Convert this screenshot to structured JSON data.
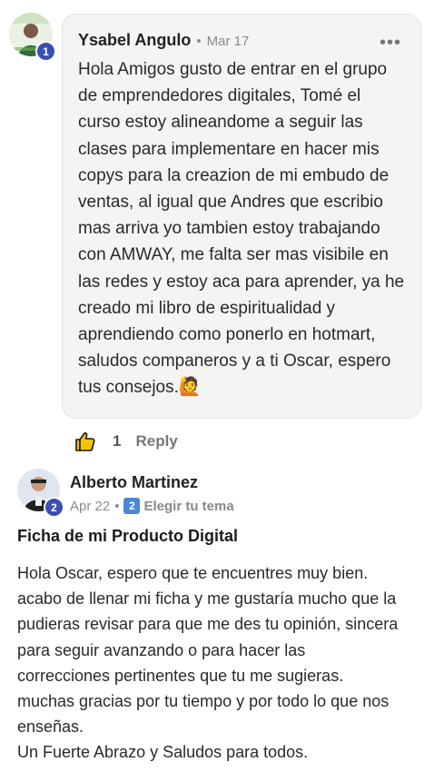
{
  "comment": {
    "author": "Ysabel Angulo",
    "separator": "•",
    "date": "Mar 17",
    "level": "1",
    "more_icon": "more-horizontal-icon",
    "more_label": "•••",
    "body": "Hola Amigos gusto de entrar en el grupo\nde emprendedores digitales, Tomé el\ncurso estoy alineandome a seguir las\nclases para implementare en hacer mis\ncopys para la creazion de mi embudo de\nventas, al igual que Andres que escribio\nmas arriva yo tambien estoy trabajando\ncon AMWAY, me falta ser mas visibile en\nlas redes y estoy aca para aprender, ya he\ncreado mi libro de espiritualidad y\naprendiendo como ponerlo en hotmart,\nsaludos companeros y a ti Oscar, espero\ntus consejos.",
    "emoji": "🙋",
    "like_count": "1",
    "reply_label": "Reply",
    "like_icon": "thumbs-up-icon"
  },
  "post": {
    "author": "Alberto Martinez",
    "level": "2",
    "date": "Apr 22",
    "separator": "•",
    "category_badge": "2",
    "category": "Elegir tu tema",
    "title": "Ficha de mi Producto Digital",
    "body": "Hola Oscar, espero que te encuentres muy bien.\nacabo de llenar mi ficha y me gustaría mucho que la\npudieras revisar para que me des tu opinión, sincera\npara seguir avanzando o para hacer las\ncorrecciones pertinentes que tu me sugieras.\nmuchas gracias por tu tiempo y por todo lo que nos\nenseñas.\nUn Fuerte Abrazo y Saludos para todos."
  },
  "colors": {
    "level_badge": "#3a4fb0",
    "category_badge": "#4a88d6",
    "bubble_bg": "#f5f4f2"
  }
}
